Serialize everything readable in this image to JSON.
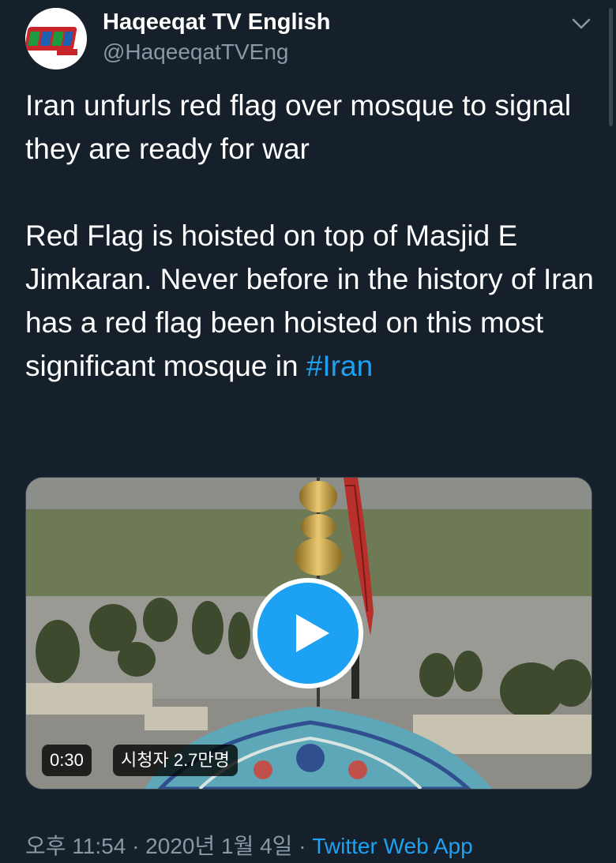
{
  "author": {
    "name": "Haqeeqat TV English",
    "handle": "@HaqeeqatTVEng",
    "avatar_text": "HAQEEQAT TV ENGLISH",
    "avatar_icon": "haqeeqat-tv-logo"
  },
  "menu_icon": "chevron-down-icon",
  "tweet": {
    "text_before_hashtag": "Iran unfurls red flag over mosque to signal they are ready for war\n\nRed Flag is hoisted on top of Masjid E Jimkaran. Never before in the history of Iran has a red flag been hoisted on this most significant mosque in ",
    "hashtag": "#Iran"
  },
  "media": {
    "type": "video",
    "duration": "0:30",
    "views": "시청자 2.7만명",
    "play_icon": "play-icon"
  },
  "meta": {
    "timestamp": "오후 11:54 · 2020년 1월 4일",
    "separator": " · ",
    "source": "Twitter Web App"
  },
  "colors": {
    "background": "#15202b",
    "accent": "#1da1f2",
    "secondary_text": "#8899a6"
  }
}
